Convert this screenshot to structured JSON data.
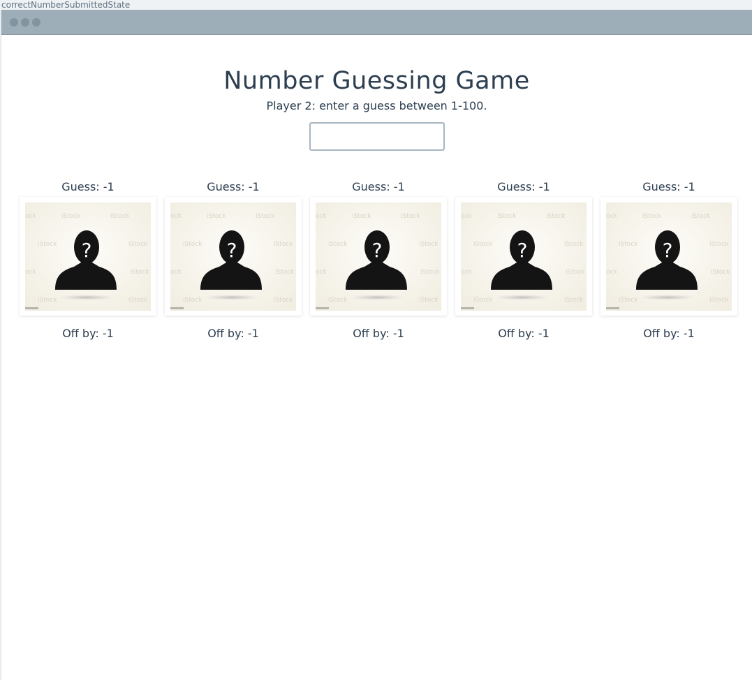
{
  "state_label": "correctNumberSubmittedState",
  "game": {
    "title": "Number Guessing Game",
    "prompt": "Player 2: enter a guess between 1-100.",
    "input_value": "",
    "input_placeholder": ""
  },
  "players": [
    {
      "guess": "Guess: -1",
      "off_by": "Off by: -1",
      "avatar_icon": "unknown-person-icon"
    },
    {
      "guess": "Guess: -1",
      "off_by": "Off by: -1",
      "avatar_icon": "unknown-person-icon"
    },
    {
      "guess": "Guess: -1",
      "off_by": "Off by: -1",
      "avatar_icon": "unknown-person-icon"
    },
    {
      "guess": "Guess: -1",
      "off_by": "Off by: -1",
      "avatar_icon": "unknown-person-icon"
    },
    {
      "guess": "Guess: -1",
      "off_by": "Off by: -1",
      "avatar_icon": "unknown-person-icon"
    }
  ],
  "watermark_text": "iStock",
  "colors": {
    "titlebar": "#9daeb9",
    "text": "#2c3e50",
    "avatar_bg": "#f7f4ec"
  }
}
